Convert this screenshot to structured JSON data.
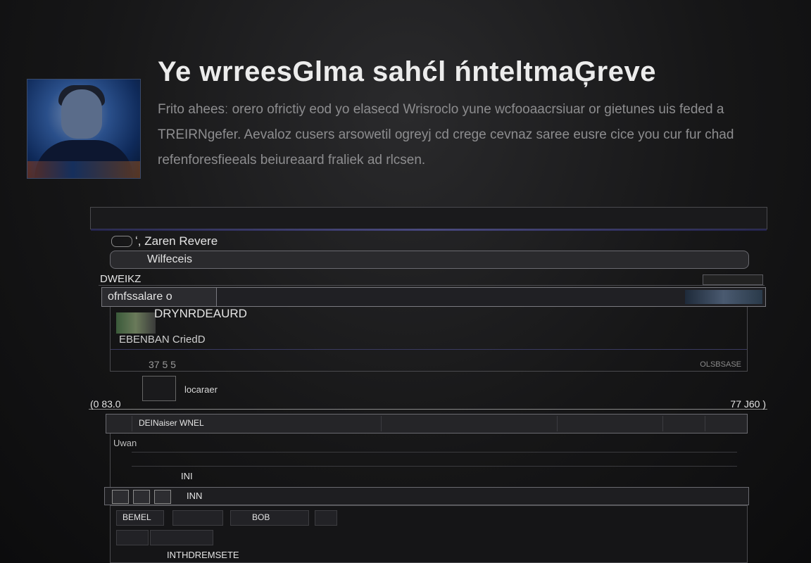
{
  "hero": {
    "title": "Ye wrreesGlma sahćl ńnteltmaĢreve",
    "description": "Frito aheesː orero ofrictiy eod yo elasecd Wrisroclo yune wcfooaacrsiuar or gietunes uis feded a TREIRNgefer. Aevaloz cusers arsowetil ogreyj cd crege cevnaz saree eusre cice you cur fur chad refenforesfieeals beiureaard fraliek ad rlcsen."
  },
  "user": {
    "name": "ʻ, Zaren Revere"
  },
  "search": {
    "value": "Wilfeceis"
  },
  "filter": {
    "label": "DWEIKZ"
  },
  "tab": {
    "label": "ofnfssalare o"
  },
  "section": {
    "title": "DRYNRDEAURD",
    "subtitle": "EBENBAN CriedD",
    "count": "37 5 5",
    "tag": "OLSBSASE"
  },
  "media": {
    "label": "locaraer"
  },
  "range": {
    "start": "(0 83.0",
    "end": "77 J60 )"
  },
  "toolbar": {
    "label": "DEINaiser WNEL"
  },
  "list": {
    "header": "Uwan",
    "count": "INI"
  },
  "controls": {
    "label": "INN"
  },
  "grid": {
    "cell_a": "BEMEL",
    "cell_b": "BOB",
    "footer": "INTHDREMSETE"
  }
}
